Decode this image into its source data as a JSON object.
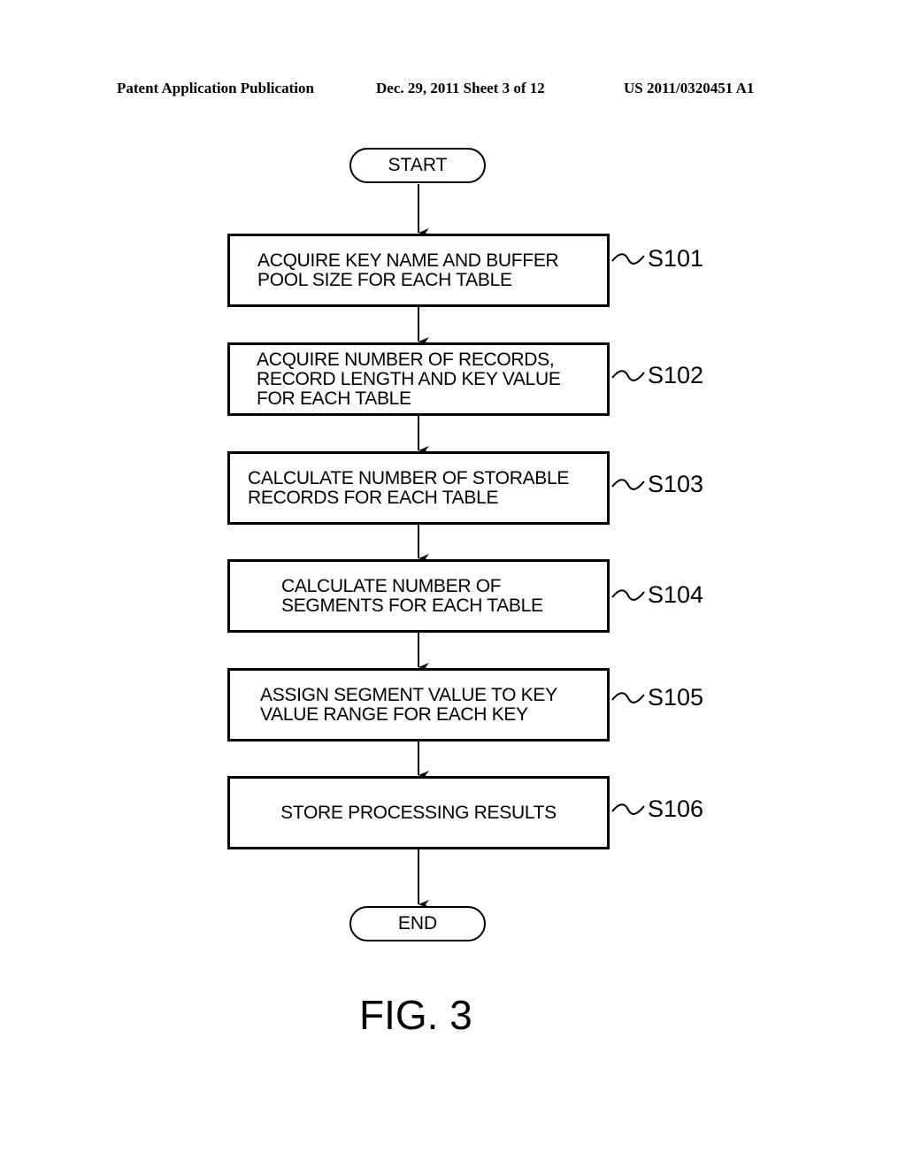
{
  "header": {
    "left": "Patent Application Publication",
    "middle": "Dec. 29, 2011   Sheet 3 of 12",
    "right": "US 2011/0320451 A1"
  },
  "flowchart": {
    "start": "START",
    "end": "END",
    "steps": [
      {
        "id": "S101",
        "lines": [
          "ACQUIRE KEY NAME AND BUFFER",
          "POOL SIZE FOR EACH TABLE"
        ]
      },
      {
        "id": "S102",
        "lines": [
          "ACQUIRE NUMBER OF RECORDS,",
          "RECORD LENGTH AND KEY VALUE",
          "FOR EACH TABLE"
        ]
      },
      {
        "id": "S103",
        "lines": [
          "CALCULATE NUMBER OF STORABLE",
          "RECORDS FOR EACH TABLE"
        ]
      },
      {
        "id": "S104",
        "lines": [
          "CALCULATE NUMBER OF",
          "SEGMENTS FOR EACH TABLE"
        ]
      },
      {
        "id": "S105",
        "lines": [
          "ASSIGN SEGMENT VALUE TO KEY",
          "VALUE RANGE FOR EACH KEY"
        ]
      },
      {
        "id": "S106",
        "lines": [
          "STORE PROCESSING RESULTS"
        ]
      }
    ]
  },
  "figure_label": "FIG. 3"
}
